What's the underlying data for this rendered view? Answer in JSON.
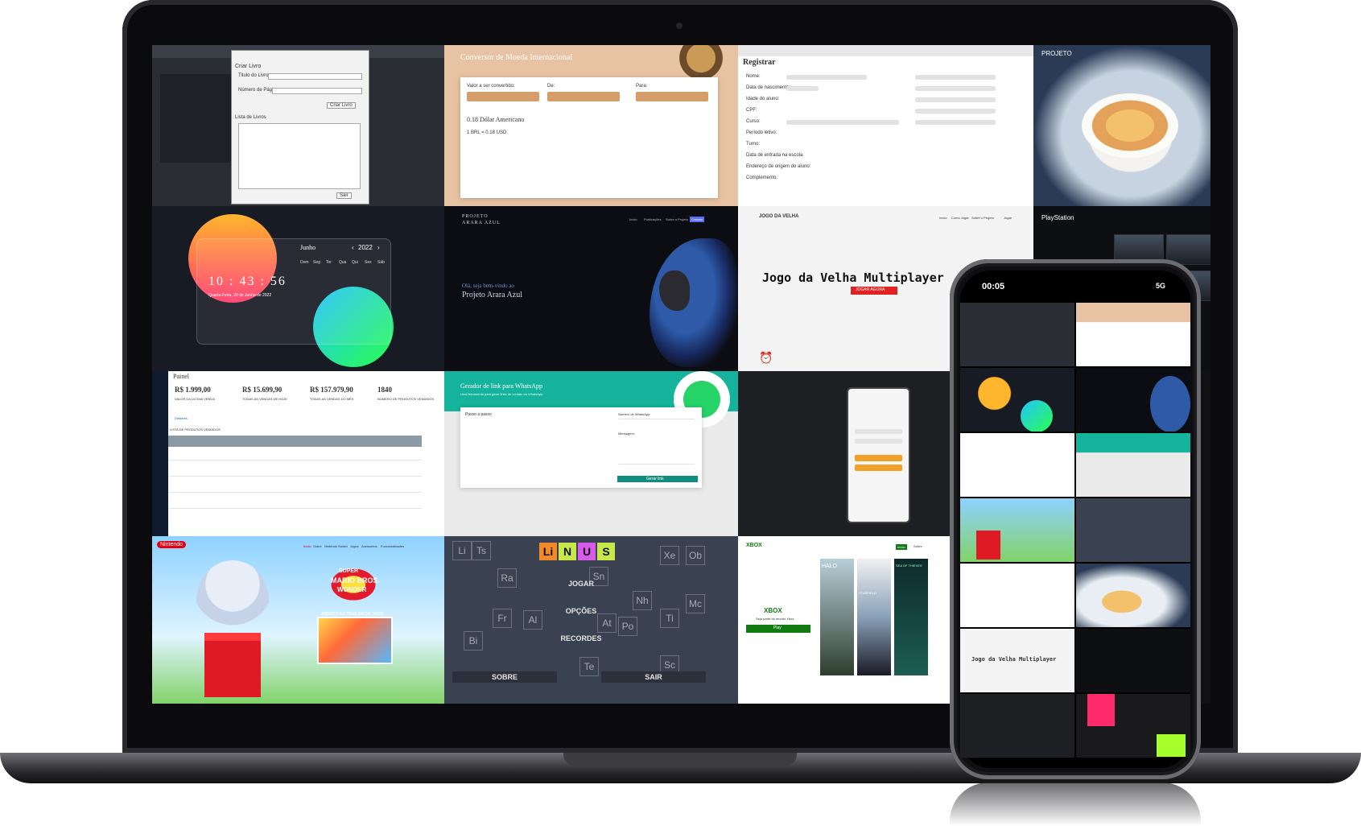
{
  "phone_status": {
    "time": "00:05",
    "network": "5G"
  },
  "ide_dialog": {
    "title": "Criar Livro",
    "field1": "Titulo do Livro:",
    "field2": "Número de Páginas:",
    "btn_create": "Criar Livro",
    "list_title": "Lista de Livros",
    "btn_sair": "Sair"
  },
  "converter": {
    "title": "Conversor de Moeda Internacional",
    "amount_label": "Valor a ser convertido:",
    "de": "De:",
    "para": "Para:",
    "result": "0.18 Dólar Americano",
    "rate": "1 BRL = 0.18 USD"
  },
  "register": {
    "title": "Registrar",
    "labels": [
      "Nome:",
      "Data de nascimento:",
      "Idade do aluno:",
      "CPF:",
      "Curso:",
      "Período letivo:",
      "Turno:",
      "Data de entrada na escola:",
      "Endereço de origem do aluno:",
      "Complemento:"
    ]
  },
  "food": {
    "title": "PROJETO"
  },
  "clock": {
    "month": "Junho",
    "year": "2022",
    "time": "10 : 43 : 56",
    "date": "Quarta-Feira, 29 de Junho de 2022",
    "weekdays": [
      "Dom",
      "Seg",
      "Ter",
      "Qua",
      "Qui",
      "Sex",
      "Sáb"
    ]
  },
  "arara": {
    "brand_line1": "PROJETO",
    "brand_line2": "ARARA AZUL",
    "hello": "Olá, seja bem-vindo ao",
    "project": "Projeto Arara Azul",
    "nav": [
      "Início",
      "Publicações",
      "Sobre o Projeto",
      "Contato"
    ]
  },
  "velha": {
    "header": "JOGO DA VELHA",
    "title": "Jogo da Velha Multiplayer",
    "button": "JOGAR AGORA",
    "nav": [
      "Início",
      "Como Jogar",
      "Sobre o Projeto",
      "Jogar"
    ]
  },
  "ps": {
    "brand": "PlayStation"
  },
  "dashboard": {
    "title": "Painel",
    "stats": [
      {
        "value": "R$ 1.999,00",
        "label": "VALOR DA ÚLTIMA VENDA"
      },
      {
        "value": "R$ 15.699,90",
        "label": "TODAS AS VENDAS DE HOJE"
      },
      {
        "value": "R$ 157.979,90",
        "label": "TODAS AS VENDAS DO MÊS"
      },
      {
        "value": "1840",
        "label": "NÚMERO DE PRODUTOS VENDIDOS"
      }
    ],
    "details": "Detalhes",
    "list_title": "LISTA DE PRODUTOS VENDIDOS"
  },
  "whatsapp": {
    "title": "Gerador de link para WhatsApp",
    "subtitle": "Uma ferramenta para gerar links de contato do WhatsApp",
    "card_title": "Passo a passo",
    "field_label": "Número de WhatsApp:",
    "msg_label": "Mensagem:",
    "button": "Gerar link"
  },
  "mario": {
    "brand": "Nintendo",
    "title_line1": "SUPER",
    "title_line2": "MARIO BROS.",
    "title_line3": "WONDER",
    "trailer": "ASSISTA AO TRAILER DO JOGO",
    "nav": [
      "Início",
      "Sobre",
      "Nintendo Switch",
      "Jogos",
      "Acessórios",
      "Funcionalidades"
    ]
  },
  "linus": {
    "logo_letters": [
      "Li",
      "N",
      "U",
      "S"
    ],
    "menu": [
      "JOGAR",
      "OPÇÕES",
      "RECORDES"
    ],
    "btn_sobre": "SOBRE",
    "btn_sair": "SAIR",
    "bg_cells": [
      "Li",
      "Ts",
      "Ra",
      "Fr",
      "Al",
      "Bi",
      "Xe",
      "Ob",
      "Mc",
      "Ti",
      "Sn",
      "Sc",
      "Po",
      "At",
      "Nh",
      "Te"
    ]
  },
  "xbox": {
    "brand": "XBOX",
    "tagline": "Seja parte do mundo Xbox",
    "button": "Play",
    "nav": [
      "Início",
      "Sobre"
    ],
    "posters": [
      "HALO",
      "STARFIELD",
      "SEA OF THIEVES"
    ]
  }
}
